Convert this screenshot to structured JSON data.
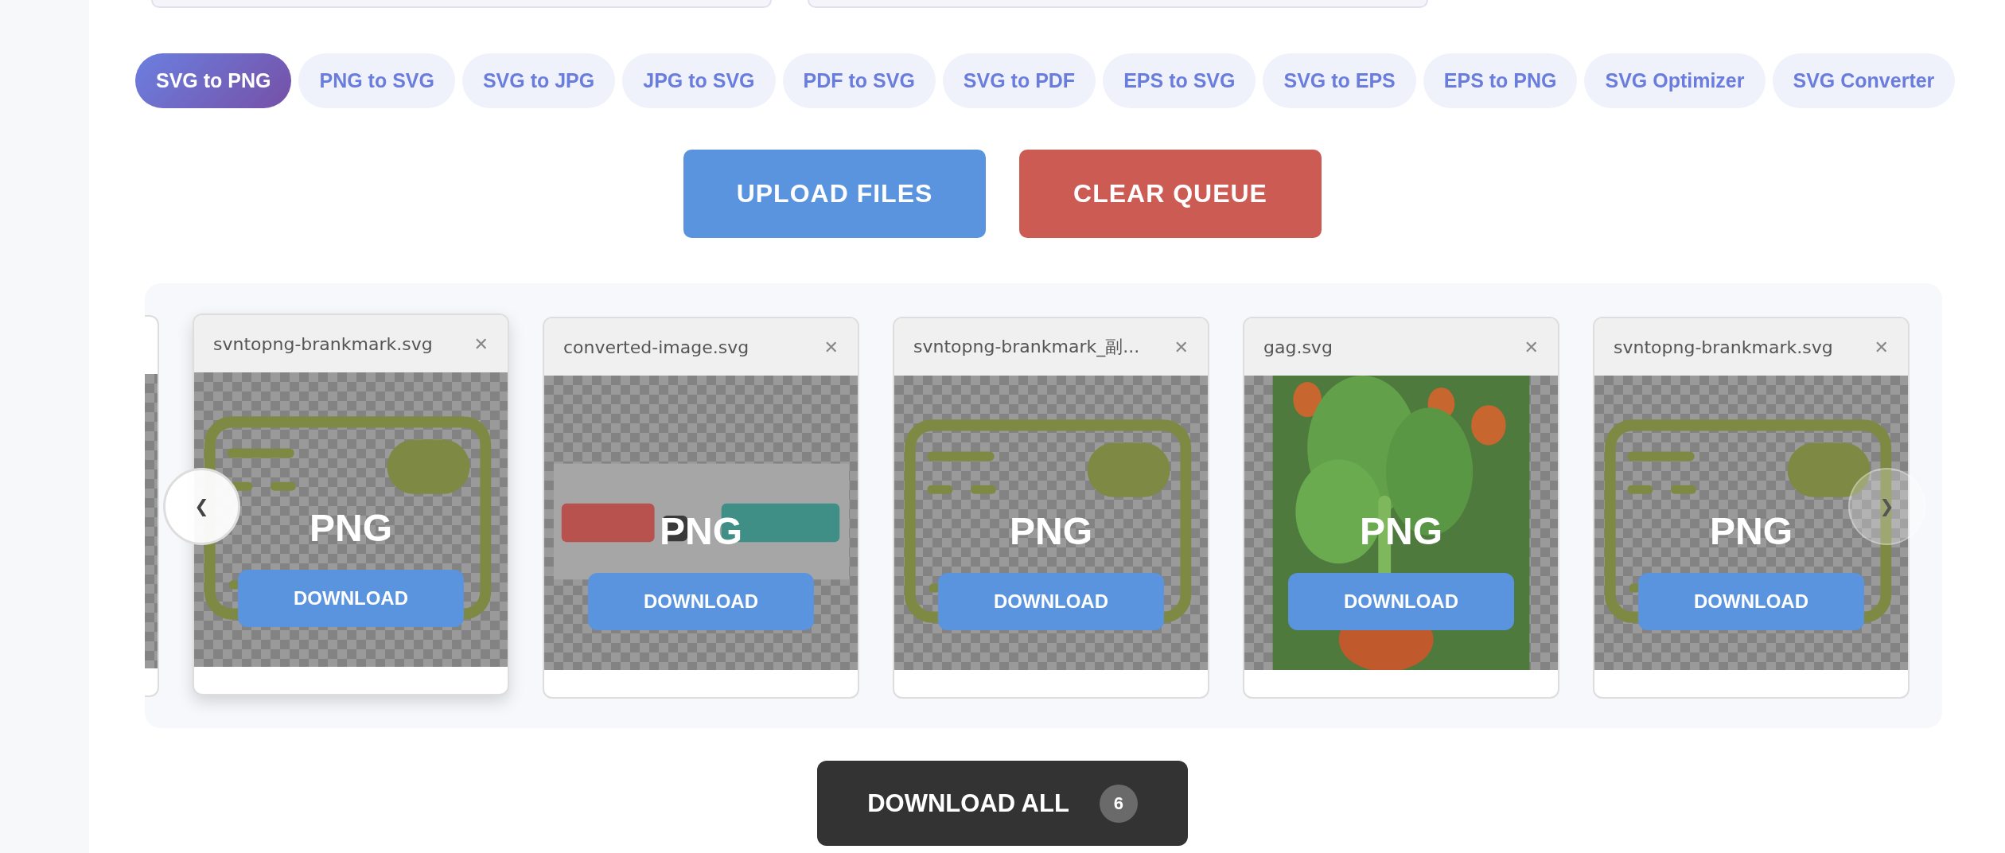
{
  "tabs": [
    {
      "label": "SVG to PNG",
      "selected": true
    },
    {
      "label": "PNG to SVG",
      "selected": false
    },
    {
      "label": "SVG to JPG",
      "selected": false
    },
    {
      "label": "JPG to SVG",
      "selected": false
    },
    {
      "label": "PDF to SVG",
      "selected": false
    },
    {
      "label": "SVG to PDF",
      "selected": false
    },
    {
      "label": "EPS to SVG",
      "selected": false
    },
    {
      "label": "SVG to EPS",
      "selected": false
    },
    {
      "label": "EPS to PNG",
      "selected": false
    },
    {
      "label": "SVG Optimizer",
      "selected": false
    },
    {
      "label": "SVG Converter",
      "selected": false
    }
  ],
  "actions": {
    "upload": "UPLOAD FILES",
    "clear": "CLEAR QUEUE"
  },
  "carousel": {
    "prev": "❮",
    "next": "❯",
    "files": [
      {
        "filename": "svntopng-brankmark.svg",
        "close": "✕",
        "format": "PNG",
        "button": "DOWNLOAD",
        "kind": "brandmark",
        "hovered": true
      },
      {
        "filename": "converted-image.svg",
        "close": "✕",
        "format": "PNG",
        "button": "DOWNLOAD",
        "kind": "logo",
        "hovered": false
      },
      {
        "filename": "svntopng-brankmark_副...",
        "close": "✕",
        "format": "PNG",
        "button": "DOWNLOAD",
        "kind": "brandmark",
        "hovered": false
      },
      {
        "filename": "gag.svg",
        "close": "✕",
        "format": "PNG",
        "button": "DOWNLOAD",
        "kind": "illustration",
        "hovered": false
      },
      {
        "filename": "svntopng-brankmark.svg",
        "close": "✕",
        "format": "PNG",
        "button": "DOWNLOAD",
        "kind": "brandmark",
        "hovered": false
      }
    ]
  },
  "download_all": {
    "label": "DOWNLOAD ALL",
    "count": "6"
  }
}
